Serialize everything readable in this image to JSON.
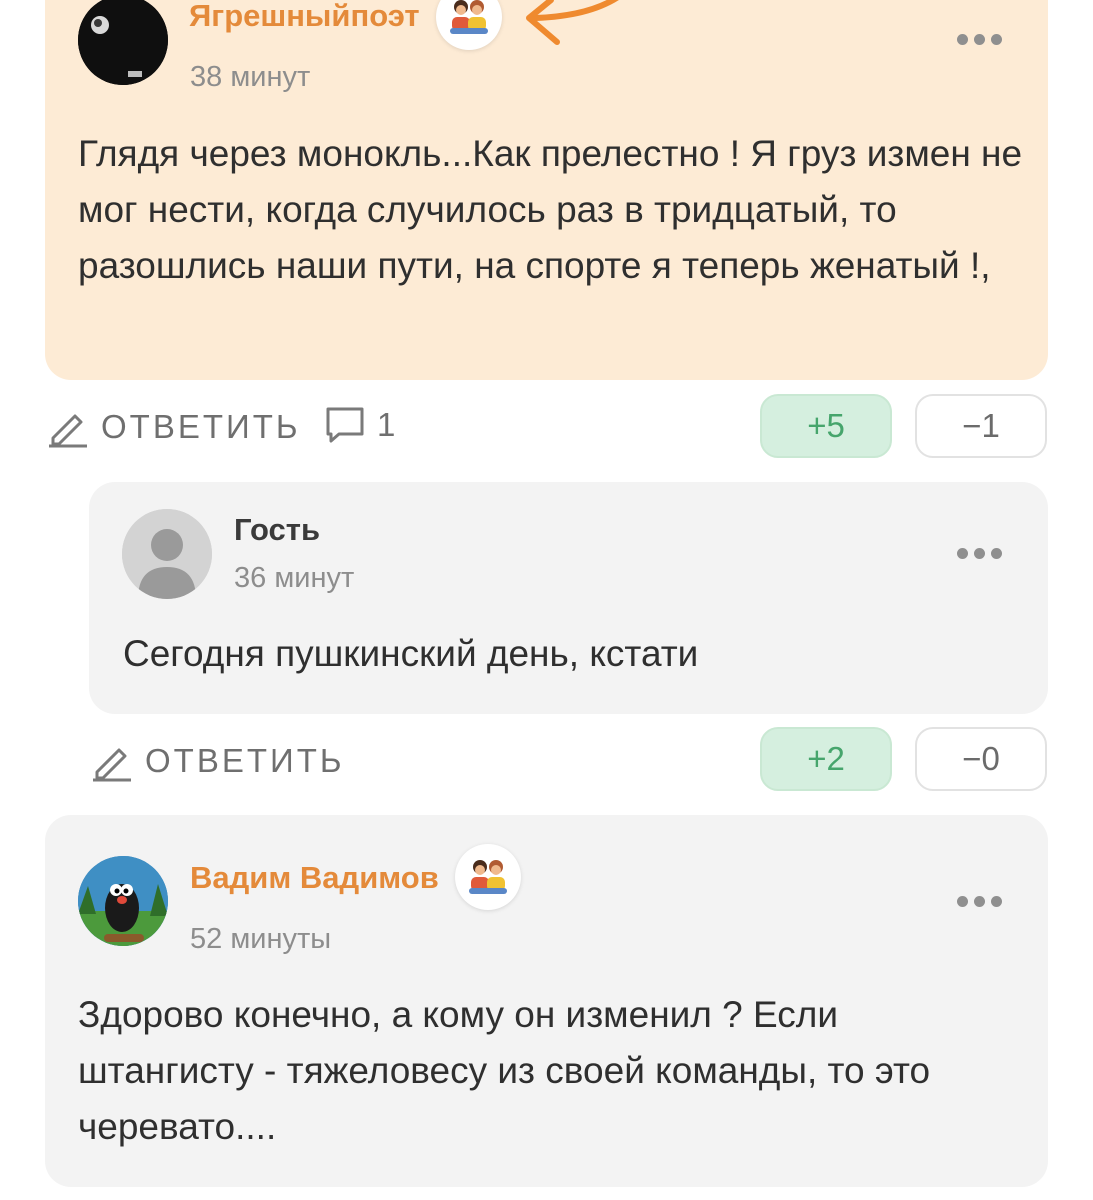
{
  "comments": [
    {
      "author": "Ягрешныйпоэт",
      "time": "38 минут",
      "text": "Глядя через монокль...Как прелестно ! Я груз измен не мог нести, когда случилось раз в тридцатый, то разошлись наши пути, на спорте я теперь женатый !,",
      "reply_label": "ОТВЕТИТЬ",
      "replies_count": "1",
      "upvotes": "+5",
      "downvotes": "−1"
    },
    {
      "author": "Гость",
      "time": "36 минут",
      "text": "Сегодня пушкинский день, кстати",
      "reply_label": "ОТВЕТИТЬ",
      "upvotes": "+2",
      "downvotes": "−0"
    },
    {
      "author": "Вадим Вадимов",
      "time": "52 минуты",
      "text": "Здорово конечно, а кому он изменил ? Если штангисту - тяжеловесу из своей команды, то это черевато....",
      "reply_label": "",
      "upvotes": "",
      "downvotes": ""
    }
  ],
  "colors": {
    "accent_orange": "#e48a3a",
    "highlight_bg": "#fdebd5",
    "card_bg": "#f3f3f3",
    "upvote_green": "#46a56c"
  },
  "icons": {
    "badge": "friends-badge-icon",
    "more": "more-dots-icon",
    "reply": "pencil-icon",
    "comments": "speech-bubble-icon"
  }
}
